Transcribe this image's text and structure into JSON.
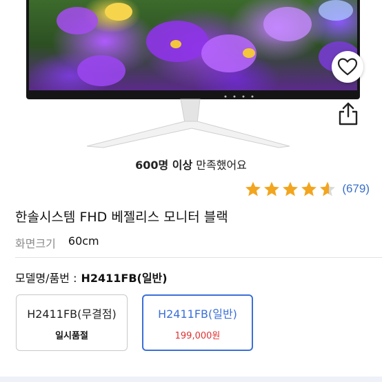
{
  "product": {
    "satisfaction_bold": "600명 이상",
    "satisfaction_rest": " 만족했어요",
    "rating_value": 4.6,
    "review_count": "(679)",
    "title": "한솔시스템 FHD 베젤리스 모니터 블랙",
    "spec_label": "화면크기",
    "spec_value": "60cm",
    "model_label": "모델명/품번 :",
    "model_value": "H2411FB(일반)"
  },
  "options": [
    {
      "name": "H2411FB(무결점)",
      "status": "일시품절"
    },
    {
      "name": "H2411FB(일반)",
      "price": "199,000원"
    }
  ],
  "icons": {
    "wishlist": "heart-icon",
    "share": "share-icon",
    "star": "star-icon"
  },
  "colors": {
    "accent_blue": "#3a6fd8",
    "star_gold": "#f2a51f",
    "price_red": "#e03030"
  }
}
